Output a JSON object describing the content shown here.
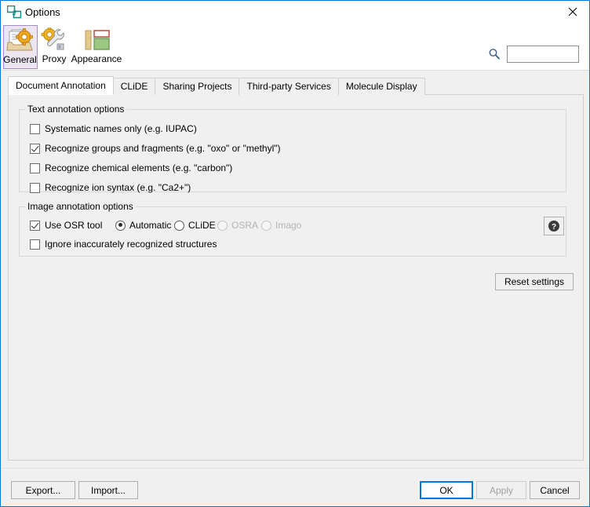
{
  "window": {
    "title": "Options",
    "title_icon": "options-window-icon",
    "close_icon": "close-icon"
  },
  "toolbar": {
    "items": [
      {
        "label": "General",
        "icon": "general-settings-icon",
        "selected": true
      },
      {
        "label": "Proxy",
        "icon": "proxy-wrench-gear-icon",
        "selected": false
      },
      {
        "label": "Appearance",
        "icon": "appearance-layout-icon",
        "selected": false
      }
    ],
    "search": {
      "icon": "search-icon",
      "value": "",
      "placeholder": ""
    }
  },
  "tabs": [
    {
      "label": "Document Annotation",
      "active": true
    },
    {
      "label": "CLiDE",
      "active": false
    },
    {
      "label": "Sharing Projects",
      "active": false
    },
    {
      "label": "Third-party Services",
      "active": false
    },
    {
      "label": "Molecule Display",
      "active": false
    }
  ],
  "text_annotation": {
    "title": "Text annotation options",
    "options": [
      {
        "label": "Systematic names only (e.g. IUPAC)",
        "checked": false
      },
      {
        "label": "Recognize groups and fragments (e.g. \"oxo\" or \"methyl\")",
        "checked": true
      },
      {
        "label": "Recognize chemical elements (e.g. \"carbon\")",
        "checked": false
      },
      {
        "label": "Recognize ion syntax (e.g. \"Ca2+\")",
        "checked": false
      }
    ]
  },
  "image_annotation": {
    "title": "Image annotation options",
    "use_osr": {
      "label": "Use OSR tool",
      "checked": true
    },
    "osr_tools": [
      {
        "label": "Automatic",
        "selected": true,
        "disabled": false
      },
      {
        "label": "CLiDE",
        "selected": false,
        "disabled": false
      },
      {
        "label": "OSRA",
        "selected": false,
        "disabled": true
      },
      {
        "label": "Imago",
        "selected": false,
        "disabled": true
      }
    ],
    "ignore_inaccurate": {
      "label": "Ignore inaccurately recognized structures",
      "checked": false
    },
    "help_icon": "help-question-icon"
  },
  "reset": {
    "label": "Reset settings"
  },
  "footer": {
    "export_label": "Export...",
    "import_label": "Import...",
    "ok_label": "OK",
    "apply_label": "Apply",
    "cancel_label": "Cancel",
    "apply_disabled": true,
    "ok_default": true
  },
  "colors": {
    "window_border": "#0078d7",
    "selected_tool_border": "#a68bc0",
    "selected_tool_background": "#ece6f3",
    "panel_background": "#f0f0f0",
    "disabled_text": "#b4b4b4"
  }
}
